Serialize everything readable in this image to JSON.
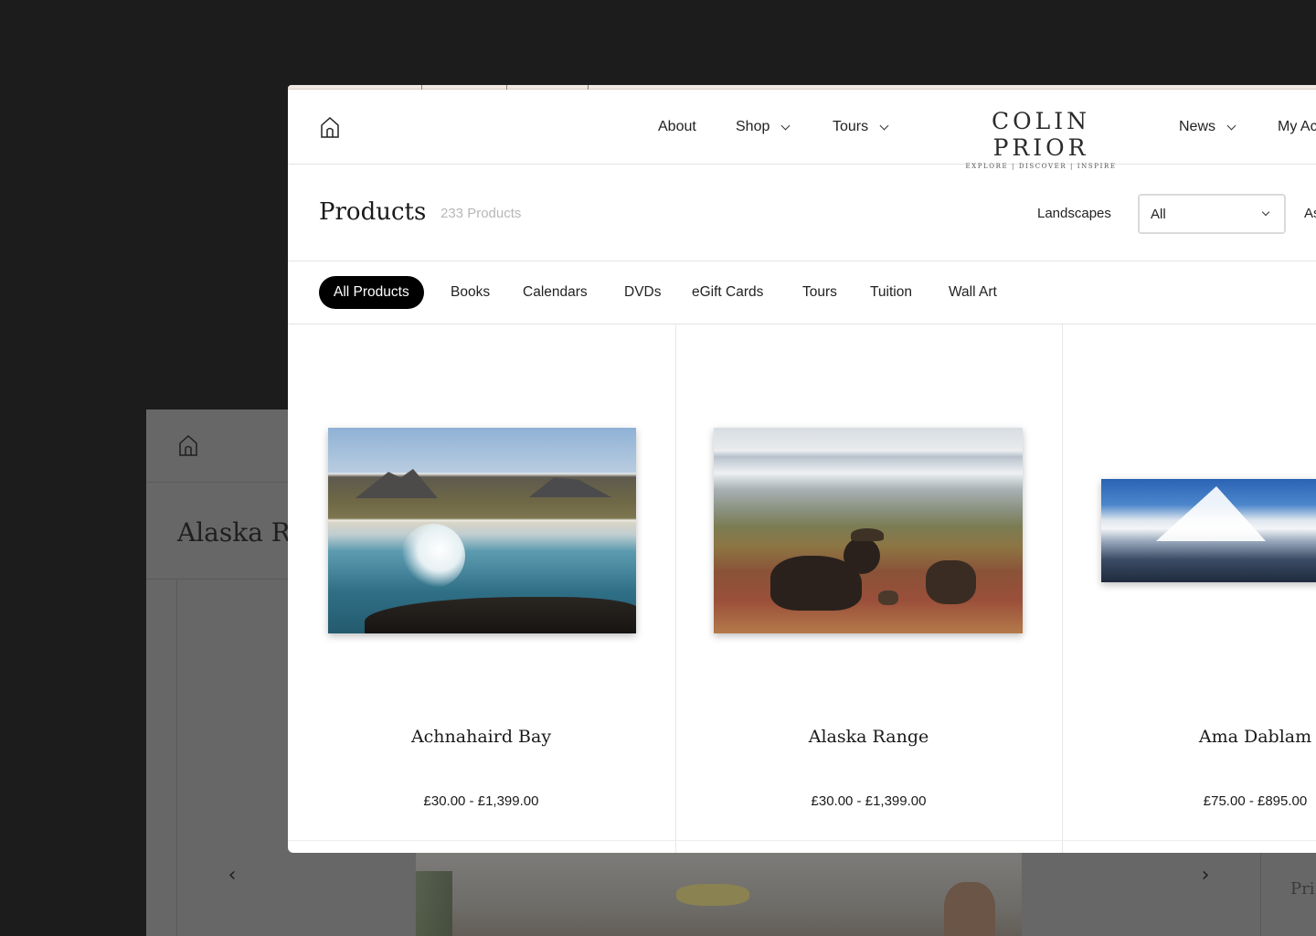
{
  "background_window": {
    "title": "Alaska Range",
    "price_label": "Pri"
  },
  "header": {
    "nav": {
      "about": "About",
      "shop": "Shop",
      "tours": "Tours",
      "news": "News",
      "my_account": "My Ac"
    },
    "logo": {
      "name": "COLIN PRIOR",
      "tagline": "EXPLORE  |  DISCOVER  |  INSPIRE"
    }
  },
  "title_bar": {
    "title": "Products",
    "count": "233 Products",
    "filter_label": "Landscapes",
    "filter_value": "All",
    "filter_label2": "As"
  },
  "categories": [
    {
      "label": "All Products",
      "active": true
    },
    {
      "label": "Books",
      "active": false
    },
    {
      "label": "Calendars",
      "active": false
    },
    {
      "label": "DVDs",
      "active": false
    },
    {
      "label": "eGift Cards",
      "active": false
    },
    {
      "label": "Tours",
      "active": false
    },
    {
      "label": "Tuition",
      "active": false
    },
    {
      "label": "Wall Art",
      "active": false
    }
  ],
  "products": [
    {
      "name": "Achnahaird Bay",
      "price": "£30.00 - £1,399.00"
    },
    {
      "name": "Alaska Range",
      "price": "£30.00 - £1,399.00"
    },
    {
      "name": "Ama Dablam",
      "price": "£75.00 - £895.00"
    }
  ],
  "colors": {
    "backdrop": "#1c1c1c",
    "active_pill": "#000000",
    "muted_text": "#b7b7b7"
  },
  "icons": [
    "home-icon",
    "chevron-down-icon",
    "chevron-left-icon",
    "chevron-right-icon"
  ]
}
